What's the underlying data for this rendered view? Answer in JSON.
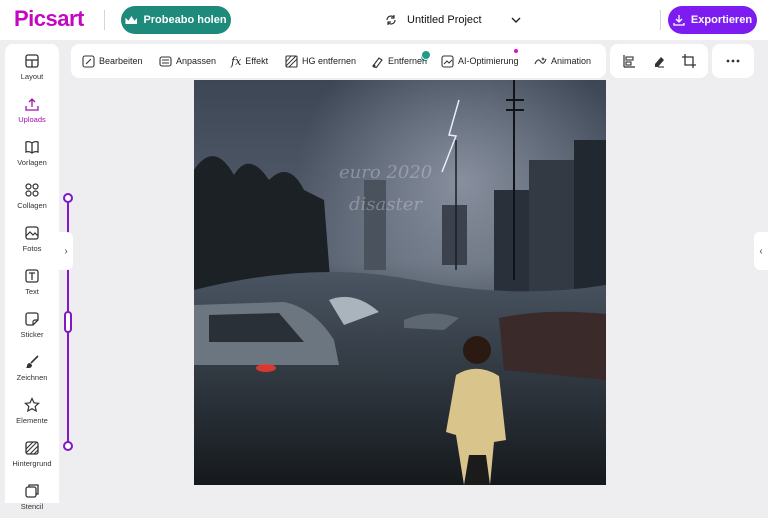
{
  "header": {
    "logo": "Picsart",
    "trial_button": "Probeabo holen",
    "project_title": "Untitled Project",
    "export_button": "Exportieren"
  },
  "sidebar": {
    "items": [
      {
        "label": "Layout",
        "icon": "layout-icon"
      },
      {
        "label": "Uploads",
        "icon": "upload-icon",
        "active": true
      },
      {
        "label": "Vorlagen",
        "icon": "book-icon"
      },
      {
        "label": "Collagen",
        "icon": "grid-icon"
      },
      {
        "label": "Fotos",
        "icon": "photo-icon"
      },
      {
        "label": "Text",
        "icon": "text-icon"
      },
      {
        "label": "Sticker",
        "icon": "sticker-icon"
      },
      {
        "label": "Zeichnen",
        "icon": "brush-icon"
      },
      {
        "label": "Elemente",
        "icon": "star-icon"
      },
      {
        "label": "Hintergrund",
        "icon": "background-icon"
      },
      {
        "label": "Stencil",
        "icon": "stencil-icon"
      }
    ]
  },
  "toolbar": {
    "tools": [
      {
        "label": "Bearbeiten"
      },
      {
        "label": "Anpassen"
      },
      {
        "label": "Effekt"
      },
      {
        "label": "HG entfernen"
      },
      {
        "label": "Entfernen"
      },
      {
        "label": "AI-Optimierung"
      },
      {
        "label": "Animation"
      }
    ]
  },
  "canvas": {
    "watermark_line1": "euro 2020",
    "watermark_line2": "disaster"
  },
  "colors": {
    "brand": "#c209c1",
    "trial": "#1d8a7c",
    "export": "#7d1cf0",
    "slider": "#8118c8"
  }
}
